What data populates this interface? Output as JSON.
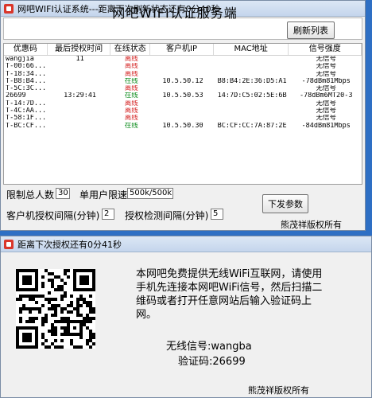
{
  "win1": {
    "title": "网吧WIFI认证系统---距离下次刷新状态还有0分40秒",
    "main_title": "网吧WIFI认证服务端",
    "refresh_label": "刷新列表",
    "columns": [
      "优惠码",
      "最后授权时间",
      "在线状态",
      "客户机IP",
      "MAC地址",
      "信号强度"
    ],
    "rows": [
      {
        "code": "wangjia",
        "time": "11",
        "status": "离线",
        "ip": "",
        "mac": "",
        "signal": "无信号",
        "online": false
      },
      {
        "code": "T-00:66...",
        "time": "",
        "status": "离线",
        "ip": "",
        "mac": "",
        "signal": "无信号",
        "online": false
      },
      {
        "code": "T-18:34...",
        "time": "",
        "status": "离线",
        "ip": "",
        "mac": "",
        "signal": "无信号",
        "online": false
      },
      {
        "code": "T-B8:B4...",
        "time": "",
        "status": "在线",
        "ip": "10.5.50.12",
        "mac": "B8:B4:2E:36:D5:A1",
        "signal": "-78dBm81Mbps",
        "online": true
      },
      {
        "code": "T-5C:3C...",
        "time": "",
        "status": "离线",
        "ip": "",
        "mac": "",
        "signal": "无信号",
        "online": false
      },
      {
        "code": "26699",
        "time": "13:29:41",
        "status": "在线",
        "ip": "10.5.50.53",
        "mac": "14:7D:C5:02:5E:6B",
        "signal": "-78dBm6MT20-3",
        "online": true
      },
      {
        "code": "T-14:7D...",
        "time": "",
        "status": "离线",
        "ip": "",
        "mac": "",
        "signal": "无信号",
        "online": false
      },
      {
        "code": "T-4C:AA...",
        "time": "",
        "status": "离线",
        "ip": "",
        "mac": "",
        "signal": "无信号",
        "online": false
      },
      {
        "code": "T-58:1F...",
        "time": "",
        "status": "离线",
        "ip": "",
        "mac": "",
        "signal": "无信号",
        "online": false
      },
      {
        "code": "T-BC:CF...",
        "time": "",
        "status": "在线",
        "ip": "10.5.50.30",
        "mac": "BC:CF:CC:7A:87:2E",
        "signal": "-84dBm81Mbps",
        "online": true
      }
    ],
    "limit_total_label": "限制总人数",
    "limit_total_value": "30",
    "single_limit_label": "单用户限速",
    "single_limit_value": "500k/500k",
    "client_interval_label": "客户机授权间隔(分钟)",
    "client_interval_value": "2",
    "check_interval_label": "授权检测间隔(分钟)",
    "check_interval_value": "5",
    "send_params_label": "下发参数",
    "copyright": "熊茂祥版权所有"
  },
  "win2": {
    "title": "距离下次授权还有0分41秒",
    "description": "本网吧免费提供无线WiFi互联网，请使用手机先连接本网吧WiFi信号，然后扫描二维码或者打开任意网站后输入验证码上网。",
    "wifi_label": "无线信号:wangba",
    "code_label": "验证码:26699",
    "copyright": "熊茂祥版权所有"
  },
  "colors": {
    "online": "#0a8a1a",
    "offline": "#d42020",
    "taskbar": "#2e6fc4"
  }
}
